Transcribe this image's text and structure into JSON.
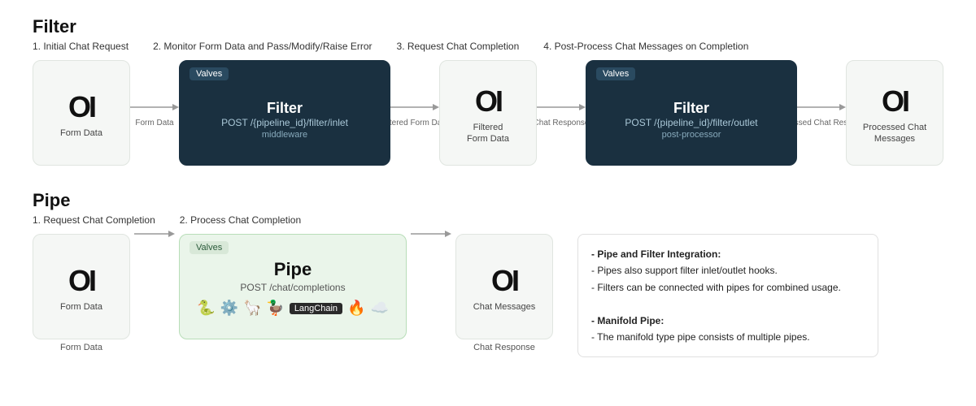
{
  "filter": {
    "title": "Filter",
    "steps": [
      "1. Initial Chat Request",
      "2. Monitor Form Data and Pass/Modify/Raise Error",
      "3. Request Chat Completion",
      "4. Post-Process Chat Messages on Completion"
    ],
    "nodes": {
      "formData": {
        "logo": "OI",
        "label": "Form Data"
      },
      "filterInlet": {
        "valves": "Valves",
        "title": "Filter",
        "endpoint": "POST /{pipeline_id}/filter/inlet",
        "sub": "middleware"
      },
      "filteredFormData": {
        "logo": "OI",
        "label1": "Filtered",
        "label2": "Form Data"
      },
      "filterOutlet": {
        "valves": "Valves",
        "title": "Filter",
        "endpoint": "POST /{pipeline_id}/filter/outlet",
        "sub": "post-processor"
      },
      "processedChat": {
        "logo": "OI",
        "label1": "Processed Chat",
        "label2": "Messages"
      }
    },
    "arrows": {
      "formData": "Form Data",
      "filteredFormData": "Filtered Form Data",
      "chatResponse": "Chat Response",
      "processedChatResponse": "Processed Chat Response"
    }
  },
  "pipe": {
    "title": "Pipe",
    "steps": [
      "1. Request Chat Completion",
      "2. Process Chat Completion"
    ],
    "nodes": {
      "formData": {
        "logo": "OI",
        "label": "Form Data"
      },
      "pipe": {
        "valves": "Valves",
        "title": "Pipe",
        "endpoint": "POST /chat/completions"
      },
      "chatMessages": {
        "logo": "OI",
        "label": "Chat Messages"
      }
    },
    "arrows": {
      "formData": "Form Data",
      "chatResponse": "Chat Response"
    },
    "info": {
      "heading1": "- Pipe and Filter Integration:",
      "line1": "  - Pipes also support filter inlet/outlet hooks.",
      "line2": "  - Filters can be connected with pipes for combined usage.",
      "heading2": "- Manifold Pipe:",
      "line3": "  - The manifold type pipe consists of multiple pipes."
    }
  }
}
